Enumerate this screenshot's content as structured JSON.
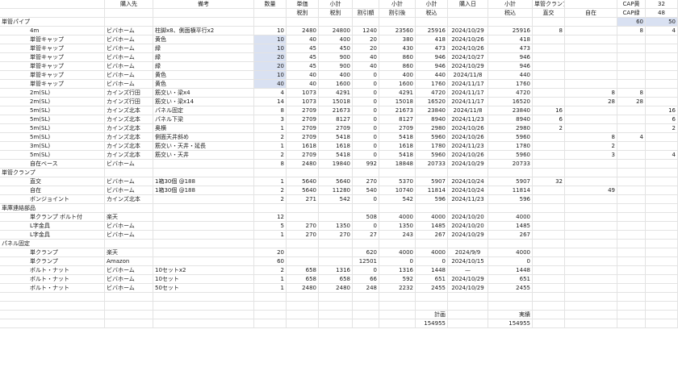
{
  "header1": [
    "",
    "購入先",
    "備考",
    "数量",
    "単価",
    "小計",
    "",
    "小計",
    "小計",
    "購入日",
    "小計",
    "単管クランプ数",
    "",
    "CAP黄",
    "32"
  ],
  "header2": [
    "",
    "",
    "",
    "",
    "税別",
    "税別",
    "割引額",
    "割引後",
    "税込",
    "",
    "税込",
    "直交",
    "自在",
    "CAP緑",
    "48"
  ],
  "header2b": [
    "",
    "",
    "",
    "",
    "",
    "",
    "",
    "",
    "",
    "",
    "",
    "",
    "",
    "60",
    "50"
  ],
  "rows": [
    {
      "sec": "単管パイプ"
    },
    {
      "c": [
        "4m",
        "ビバホーム",
        "柱脚x8、側面横平行x2",
        "10",
        "2480",
        "24800",
        "1240",
        "23560",
        "25916",
        "2024/10/29",
        "25916",
        "8",
        "",
        "8",
        "4"
      ]
    },
    {
      "c": [
        "単管キャップ",
        "ビバホーム",
        "黄色",
        "10",
        "40",
        "400",
        "20",
        "380",
        "418",
        "2024/10/26",
        "418",
        "",
        "",
        "",
        ""
      ],
      "bq": true
    },
    {
      "c": [
        "単管キャップ",
        "ビバホーム",
        "緑",
        "10",
        "45",
        "450",
        "20",
        "430",
        "473",
        "2024/10/26",
        "473",
        "",
        "",
        "",
        ""
      ],
      "bq": true
    },
    {
      "c": [
        "単管キャップ",
        "ビバホーム",
        "緑",
        "20",
        "45",
        "900",
        "40",
        "860",
        "946",
        "2024/10/27",
        "946",
        "",
        "",
        "",
        ""
      ],
      "bq": true
    },
    {
      "c": [
        "単管キャップ",
        "ビバホーム",
        "緑",
        "20",
        "45",
        "900",
        "40",
        "860",
        "946",
        "2024/10/29",
        "946",
        "",
        "",
        "",
        ""
      ],
      "bq": true
    },
    {
      "c": [
        "単管キャップ",
        "ビバホーム",
        "黄色",
        "10",
        "40",
        "400",
        "0",
        "400",
        "440",
        "2024/11/8",
        "440",
        "",
        "",
        "",
        ""
      ],
      "bq": true
    },
    {
      "c": [
        "単管キャップ",
        "ビバホーム",
        "黄色",
        "40",
        "40",
        "1600",
        "0",
        "1600",
        "1760",
        "2024/11/17",
        "1760",
        "",
        "",
        "",
        ""
      ],
      "bq": true
    },
    {
      "c": [
        "2m(SL)",
        "カインズ行田",
        "筋交い・梁x4",
        "4",
        "1073",
        "4291",
        "0",
        "4291",
        "4720",
        "2024/11/17",
        "4720",
        "",
        "8",
        "8",
        ""
      ]
    },
    {
      "c": [
        "2m(SL)",
        "カインズ行田",
        "筋交い・梁x14",
        "14",
        "1073",
        "15018",
        "0",
        "15018",
        "16520",
        "2024/11/17",
        "16520",
        "",
        "28",
        "28",
        ""
      ]
    },
    {
      "c": [
        "5m(SL)",
        "カインズ北本",
        "パネル固定",
        "8",
        "2709",
        "21673",
        "0",
        "21673",
        "23840",
        "2024/11/8",
        "23840",
        "16",
        "",
        "",
        "16"
      ]
    },
    {
      "c": [
        "5m(SL)",
        "カインズ北本",
        "パネル下梁",
        "3",
        "2709",
        "8127",
        "0",
        "8127",
        "8940",
        "2024/11/23",
        "8940",
        "6",
        "",
        "",
        "6"
      ]
    },
    {
      "c": [
        "5m(SL)",
        "カインズ北本",
        "奥横",
        "1",
        "2709",
        "2709",
        "0",
        "2709",
        "2980",
        "2024/10/26",
        "2980",
        "2",
        "",
        "",
        "2"
      ]
    },
    {
      "c": [
        "5m(SL)",
        "カインズ北本",
        "側面天井斜め",
        "2",
        "2709",
        "5418",
        "0",
        "5418",
        "5960",
        "2024/10/26",
        "5960",
        "",
        "8",
        "4",
        ""
      ]
    },
    {
      "c": [
        "3m(SL)",
        "カインズ北本",
        "筋交い・天井・延長",
        "1",
        "1618",
        "1618",
        "0",
        "1618",
        "1780",
        "2024/11/23",
        "1780",
        "",
        "2",
        "",
        ""
      ]
    },
    {
      "c": [
        "5m(SL)",
        "カインズ北本",
        "筋交い・天井",
        "2",
        "2709",
        "5418",
        "0",
        "5418",
        "5960",
        "2024/10/26",
        "5960",
        "",
        "3",
        "",
        "4"
      ]
    },
    {
      "c": [
        "自在ベース",
        "ビバホーム",
        "",
        "8",
        "2480",
        "19840",
        "992",
        "18848",
        "20733",
        "2024/10/29",
        "20733",
        "",
        "",
        "",
        ""
      ]
    },
    {
      "sec": "単管クランプ"
    },
    {
      "c": [
        "直交",
        "ビバホーム",
        "1箱30個 @188",
        "1",
        "5640",
        "5640",
        "270",
        "5370",
        "5907",
        "2024/10/24",
        "5907",
        "32",
        "",
        "",
        ""
      ]
    },
    {
      "c": [
        "自在",
        "ビバホーム",
        "1箱30個 @188",
        "2",
        "5640",
        "11280",
        "540",
        "10740",
        "11814",
        "2024/10/24",
        "11814",
        "",
        "49",
        "",
        ""
      ]
    },
    {
      "c": [
        "ボンジョイント",
        "カインズ北本",
        "",
        "2",
        "271",
        "542",
        "0",
        "542",
        "596",
        "2024/11/23",
        "596",
        "",
        "",
        "",
        ""
      ]
    },
    {
      "sec": "車庫連結部品"
    },
    {
      "c": [
        "単クランプ ボルト付",
        "楽天",
        "",
        "12",
        "",
        "",
        "508",
        "4000",
        "4000",
        "2024/10/20",
        "4000",
        "",
        "",
        "",
        ""
      ]
    },
    {
      "c": [
        "L字金具",
        "ビバホーム",
        "",
        "5",
        "270",
        "1350",
        "0",
        "1350",
        "1485",
        "2024/10/20",
        "1485",
        "",
        "",
        "",
        ""
      ]
    },
    {
      "c": [
        "L字金具",
        "ビバホーム",
        "",
        "1",
        "270",
        "270",
        "27",
        "243",
        "267",
        "2024/10/29",
        "267",
        "",
        "",
        "",
        ""
      ]
    },
    {
      "sec": "パネル固定"
    },
    {
      "c": [
        "単クランプ",
        "楽天",
        "",
        "20",
        "",
        "",
        "620",
        "4000",
        "4000",
        "2024/9/9",
        "4000",
        "",
        "",
        "",
        ""
      ]
    },
    {
      "c": [
        "単クランプ",
        "Amazon",
        "",
        "60",
        "",
        "",
        "12501",
        "0",
        "0",
        "2024/10/15",
        "0",
        "",
        "",
        "",
        ""
      ]
    },
    {
      "c": [
        "ボルト・ナット",
        "ビバホーム",
        "10セットx2",
        "2",
        "658",
        "1316",
        "0",
        "1316",
        "1448",
        "—",
        "1448",
        "",
        "",
        "",
        ""
      ]
    },
    {
      "c": [
        "ボルト・ナット",
        "ビバホーム",
        "10セット",
        "1",
        "658",
        "658",
        "66",
        "592",
        "651",
        "2024/10/29",
        "651",
        "",
        "",
        "",
        ""
      ]
    },
    {
      "c": [
        "ボルト・ナット",
        "ビバホーム",
        "50セット",
        "1",
        "2480",
        "2480",
        "248",
        "2232",
        "2455",
        "2024/10/29",
        "2455",
        "",
        "",
        "",
        ""
      ]
    },
    {
      "c": [
        "",
        "",
        "",
        "",
        "",
        "",
        "",
        "",
        "",
        "",
        "",
        "",
        "",
        "",
        ""
      ]
    },
    {
      "c": [
        "",
        "",
        "",
        "",
        "",
        "",
        "",
        "",
        "",
        "",
        "",
        "",
        "",
        "",
        ""
      ]
    },
    {
      "c": [
        "",
        "",
        "",
        "",
        "",
        "",
        "",
        "",
        "計画",
        "",
        "実績",
        "",
        "",
        "",
        ""
      ]
    },
    {
      "c": [
        "",
        "",
        "",
        "",
        "",
        "",
        "",
        "",
        "154955",
        "",
        "154955",
        "",
        "",
        "",
        ""
      ]
    }
  ],
  "accent_color": "#d9e1f2"
}
